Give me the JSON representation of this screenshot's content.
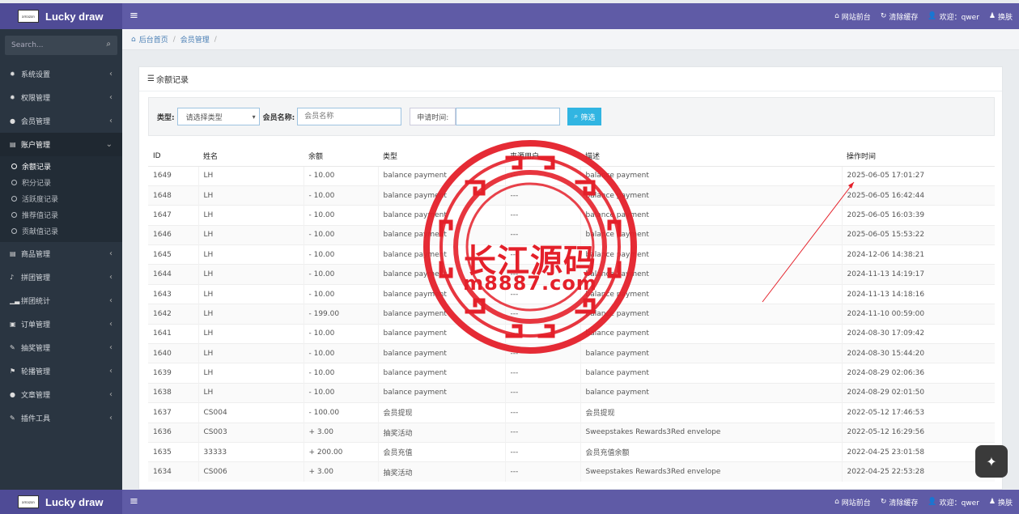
{
  "brand": {
    "name": "Lucky draw",
    "logo_text": "amazon"
  },
  "topbar": {
    "menu_icon": "hamburger-icon",
    "frontend_label": "网站前台",
    "clear_cache_label": "清除缓存",
    "welcome_label": "欢迎：qwer",
    "skin_label": "换肤"
  },
  "sidebar": {
    "search_placeholder": "Search...",
    "items": [
      {
        "label": "系统设置",
        "icon": "gear-icon"
      },
      {
        "label": "权限管理",
        "icon": "gears-icon"
      },
      {
        "label": "会员管理",
        "icon": "user-icon"
      },
      {
        "label": "账户管理",
        "icon": "book-icon",
        "active": true
      },
      {
        "label": "商品管理",
        "icon": "book-icon"
      },
      {
        "label": "拼团管理",
        "icon": "bell-icon"
      },
      {
        "label": "拼团统计",
        "icon": "signal-icon"
      },
      {
        "label": "订单管理",
        "icon": "money-icon"
      },
      {
        "label": "抽奖管理",
        "icon": "wand-icon"
      },
      {
        "label": "轮播管理",
        "icon": "flag-icon"
      },
      {
        "label": "文章管理",
        "icon": "comments-icon"
      },
      {
        "label": "插件工具",
        "icon": "wand-icon"
      }
    ],
    "subitems": [
      "余额记录",
      "积分记录",
      "活跃度记录",
      "推荐值记录",
      "贡献值记录"
    ]
  },
  "breadcrumb": {
    "home": "后台首页",
    "section": "会员管理"
  },
  "panel": {
    "title": "余额记录"
  },
  "filter": {
    "type_label": "类型:",
    "type_value": "请选择类型",
    "member_label": "会员名称:",
    "member_placeholder": "会员名称",
    "time_label": "申请时间:",
    "filter_button": "筛选"
  },
  "table": {
    "headers": [
      "ID",
      "姓名",
      "余额",
      "类型",
      "来源用户",
      "描述",
      "操作时间"
    ],
    "rows": [
      [
        "1649",
        "LH",
        "- 10.00",
        "balance payment",
        "---",
        "balance payment",
        "2025-06-05 17:01:27"
      ],
      [
        "1648",
        "LH",
        "- 10.00",
        "balance payment",
        "---",
        "balance payment",
        "2025-06-05 16:42:44"
      ],
      [
        "1647",
        "LH",
        "- 10.00",
        "balance payment",
        "---",
        "balance payment",
        "2025-06-05 16:03:39"
      ],
      [
        "1646",
        "LH",
        "- 10.00",
        "balance payment",
        "---",
        "balance payment",
        "2025-06-05 15:53:22"
      ],
      [
        "1645",
        "LH",
        "- 10.00",
        "balance payment",
        "---",
        "balance payment",
        "2024-12-06 14:38:21"
      ],
      [
        "1644",
        "LH",
        "- 10.00",
        "balance payment",
        "---",
        "balance payment",
        "2024-11-13 14:19:17"
      ],
      [
        "1643",
        "LH",
        "- 10.00",
        "balance payment",
        "---",
        "balance payment",
        "2024-11-13 14:18:16"
      ],
      [
        "1642",
        "LH",
        "- 199.00",
        "balance payment",
        "---",
        "balance payment",
        "2024-11-10 00:59:00"
      ],
      [
        "1641",
        "LH",
        "- 10.00",
        "balance payment",
        "---",
        "balance payment",
        "2024-08-30 17:09:42"
      ],
      [
        "1640",
        "LH",
        "- 10.00",
        "balance payment",
        "---",
        "balance payment",
        "2024-08-30 15:44:20"
      ],
      [
        "1639",
        "LH",
        "- 10.00",
        "balance payment",
        "---",
        "balance payment",
        "2024-08-29 02:06:36"
      ],
      [
        "1638",
        "LH",
        "- 10.00",
        "balance payment",
        "---",
        "balance payment",
        "2024-08-29 02:01:50"
      ],
      [
        "1637",
        "CS004",
        "- 100.00",
        "会员提现",
        "---",
        "会员提现",
        "2022-05-12 17:46:53"
      ],
      [
        "1636",
        "CS003",
        "+ 3.00",
        "抽奖活动",
        "---",
        "Sweepstakes Rewards3Red envelope",
        "2022-05-12 16:29:56"
      ],
      [
        "1635",
        "33333",
        "+ 200.00",
        "会员充值",
        "---",
        "会员充值余额",
        "2022-04-25 23:01:58"
      ],
      [
        "1634",
        "CS006",
        "+ 3.00",
        "抽奖活动",
        "---",
        "Sweepstakes Rewards3Red envelope",
        "2022-04-25 22:53:28"
      ]
    ]
  },
  "watermark": {
    "line1": "长江源码",
    "line2": "m8887.com"
  },
  "colors": {
    "topbar": "#5f5ba6",
    "sidebar": "#2a3541",
    "accent": "#31b5e2",
    "stamp": "#e4202a"
  }
}
